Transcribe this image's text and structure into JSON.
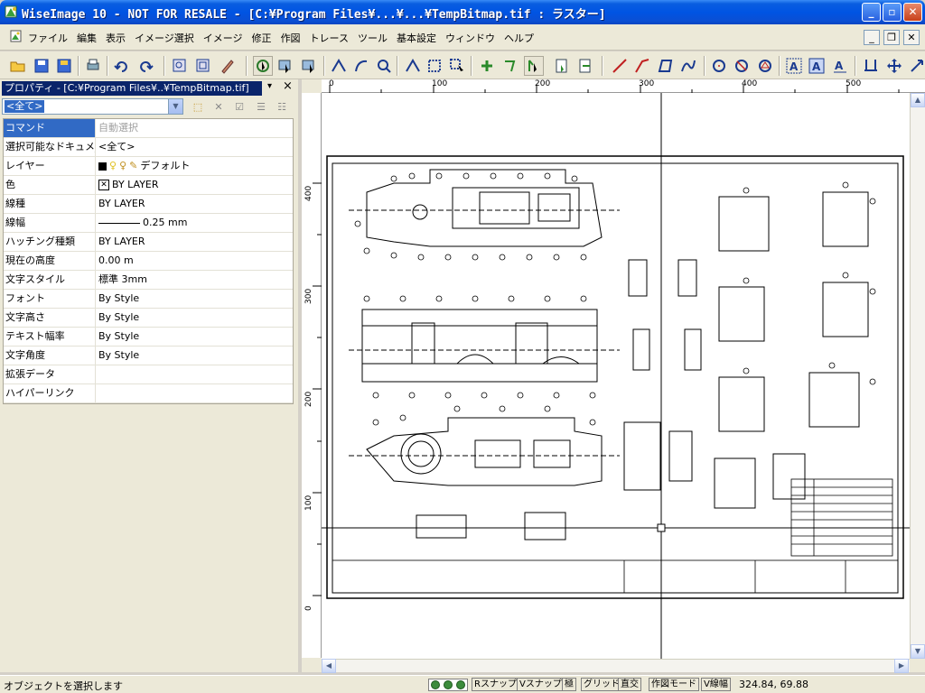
{
  "window": {
    "title": "WiseImage 10 - NOT FOR RESALE - [C:¥Program Files¥...¥...¥TempBitmap.tif : ラスター]",
    "minimize_icon": "minimize-icon",
    "maximize_icon": "restore-icon",
    "close_label": "✕"
  },
  "menu": {
    "items": [
      "ファイル",
      "編集",
      "表示",
      "イメージ選択",
      "イメージ",
      "修正",
      "作図",
      "トレース",
      "ツール",
      "基本設定",
      "ウィンドウ",
      "ヘルプ"
    ]
  },
  "properties": {
    "header": "プロパティ - [C:¥Program Files¥..¥TempBitmap.tif]",
    "selector_value": "<全て>",
    "rows": [
      {
        "key": "コマンド",
        "value": "自動選択"
      },
      {
        "key": "選択可能なドキュメ_",
        "value": "<全て>"
      },
      {
        "key": "レイヤー",
        "value": "デフォルト"
      },
      {
        "key": "色",
        "value": "BY LAYER"
      },
      {
        "key": "線種",
        "value": "BY LAYER"
      },
      {
        "key": "線幅",
        "value": "0.25 mm"
      },
      {
        "key": "ハッチング種類",
        "value": "BY LAYER"
      },
      {
        "key": "現在の高度",
        "value": "0.00 m"
      },
      {
        "key": "文字スタイル",
        "value": "標準 3mm"
      },
      {
        "key": "フォント",
        "value": "By Style"
      },
      {
        "key": "文字高さ",
        "value": "By Style"
      },
      {
        "key": "テキスト幅率",
        "value": "By Style"
      },
      {
        "key": "文字角度",
        "value": "By Style"
      },
      {
        "key": "拡張データ",
        "value": ""
      },
      {
        "key": "ハイパーリンク",
        "value": ""
      }
    ]
  },
  "rulers": {
    "h_ticks": [
      "0",
      "100",
      "200",
      "300",
      "400",
      "500"
    ],
    "v_ticks": [
      "400",
      "300",
      "200",
      "100",
      "0"
    ]
  },
  "status": {
    "message": "オブジェクトを選択します",
    "buttons": [
      "Rスナップ",
      "Vスナップ",
      "極",
      "グリッド",
      "直交",
      "作図モード",
      "V線幅"
    ],
    "coordinates": "324.84, 69.88"
  },
  "colors": {
    "titlebar": "#0054e3",
    "selection": "#316ac5",
    "header": "#0a246a"
  }
}
